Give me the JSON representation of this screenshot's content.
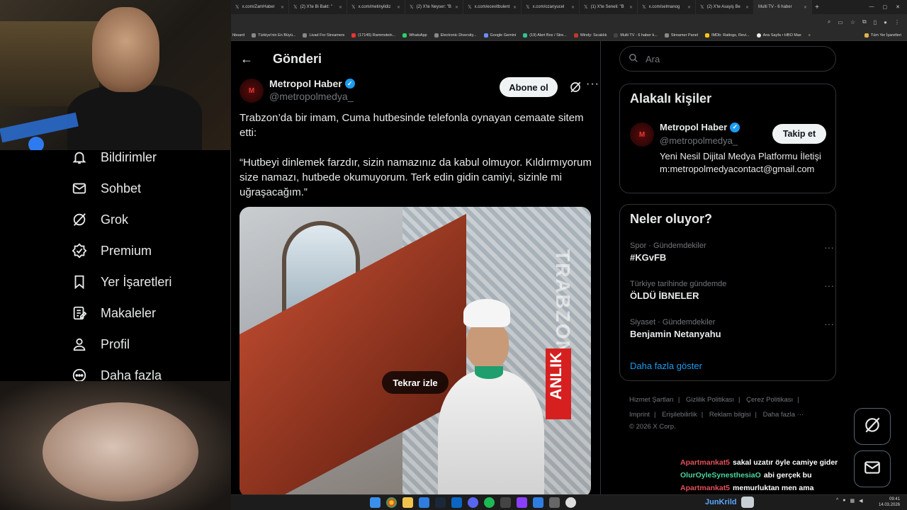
{
  "browser": {
    "tabs": [
      {
        "label": "x.com/ZamHaber"
      },
      {
        "label": "(2) X'te Bi Bakt: \""
      },
      {
        "label": "x.com/metinyildiz"
      },
      {
        "label": "(2) X'te Neyser: \"B"
      },
      {
        "label": "x.com/ecevitbulent"
      },
      {
        "label": "x.com/ozanyucel"
      },
      {
        "label": "(1) X'te Seneli: \"B"
      },
      {
        "label": "x.com/selmanog"
      },
      {
        "label": "(2) X'te Asayiş Be"
      },
      {
        "label": "Multi TV - 6 haber"
      }
    ],
    "bookmarks": [
      "hboard",
      "Türkiye'nin En Büyü...",
      "Livad For Streamers",
      "(17145) Rammstein...",
      "WhatsApp",
      "Electronic Diversity...",
      "Google Gemini",
      "(19) Alert Box / Stre...",
      "Windy: Sıcaklık",
      "Multi TV - 6 haber k...",
      "Streamer Panel",
      "IMDb: Ratings, Revi...",
      "Ana Sayfa • HBO Max"
    ],
    "all_bookmarks": "Tüm Yer İşaretleri"
  },
  "nav": {
    "items": [
      {
        "label": "Bildirimler",
        "icon": "bell-icon"
      },
      {
        "label": "Sohbet",
        "icon": "mail-icon"
      },
      {
        "label": "Grok",
        "icon": "grok-icon"
      },
      {
        "label": "Premium",
        "icon": "verified-badge-icon"
      },
      {
        "label": "Yer İşaretleri",
        "icon": "bookmark-icon"
      },
      {
        "label": "Makaleler",
        "icon": "article-icon"
      },
      {
        "label": "Profil",
        "icon": "person-icon"
      },
      {
        "label": "Daha fazla",
        "icon": "more-circle-icon"
      }
    ]
  },
  "main": {
    "title": "Gönderi",
    "post": {
      "author_name": "Metropol Haber",
      "author_handle": "@metropolmedya_",
      "subscribe_label": "Abone ol",
      "text_p1": "Trabzon’da bir imam, Cuma hutbesinde telefonla oynayan cemaate sitem etti:",
      "text_p2": "“Hutbeyi dinlemek farzdır, sizin namazınız da kabul olmuyor. Kıldırmıyorum size namazı, hutbede okumuyorum. Terk edin gidin camiyi, sizinle mi uğraşacağım.”",
      "video_overlay_1": "TRABZON",
      "video_overlay_2": "ANLIK",
      "replay_label": "Tekrar izle"
    }
  },
  "right": {
    "search_placeholder": "Ara",
    "related": {
      "title": "Alakalı kişiler",
      "name": "Metropol Haber",
      "handle": "@metropolmedya_",
      "follow_label": "Takip et",
      "bio": "Yeni Nesil Dijital Medya Platformu İletişim:metropolmedyacontact@gmail.com"
    },
    "trends": {
      "title": "Neler oluyor?",
      "items": [
        {
          "meta": "Spor · Gündemdekiler",
          "name": "#KGvFB"
        },
        {
          "meta": "Türkiye tarihinde gündemde",
          "name": "ÖLDÜ İBNELER"
        },
        {
          "meta": "Siyaset · Gündemdekiler",
          "name": "Benjamin Netanyahu"
        }
      ],
      "show_more": "Daha fazla göster"
    },
    "footer": {
      "links": [
        "Hizmet Şartları",
        "Gizlilik Politikası",
        "Çerez Politikası",
        "Imprint",
        "Erişilebilirlik",
        "Reklam bilgisi",
        "Daha fazla ···"
      ],
      "copyright": "© 2026 X Corp."
    }
  },
  "chat": {
    "lines": [
      {
        "user": "Apartmankat5",
        "msg": "sakal uzatır öyle camiye gider",
        "color": "#e5505a"
      },
      {
        "user": "OlurOyleSynesthesiaO",
        "msg": "abi gerçek bu",
        "color": "#4bd6a0"
      },
      {
        "user": "Apartmankat5",
        "msg": "memurluktan men ama",
        "color": "#e5505a"
      }
    ]
  },
  "taskbar": {
    "user": "JunKrild",
    "time": "09:41",
    "date": "14.03.2026"
  },
  "colors": {
    "accent": "#1d9bf0",
    "background": "#000000",
    "border": "#2f3336",
    "muted_text": "#71767b"
  }
}
